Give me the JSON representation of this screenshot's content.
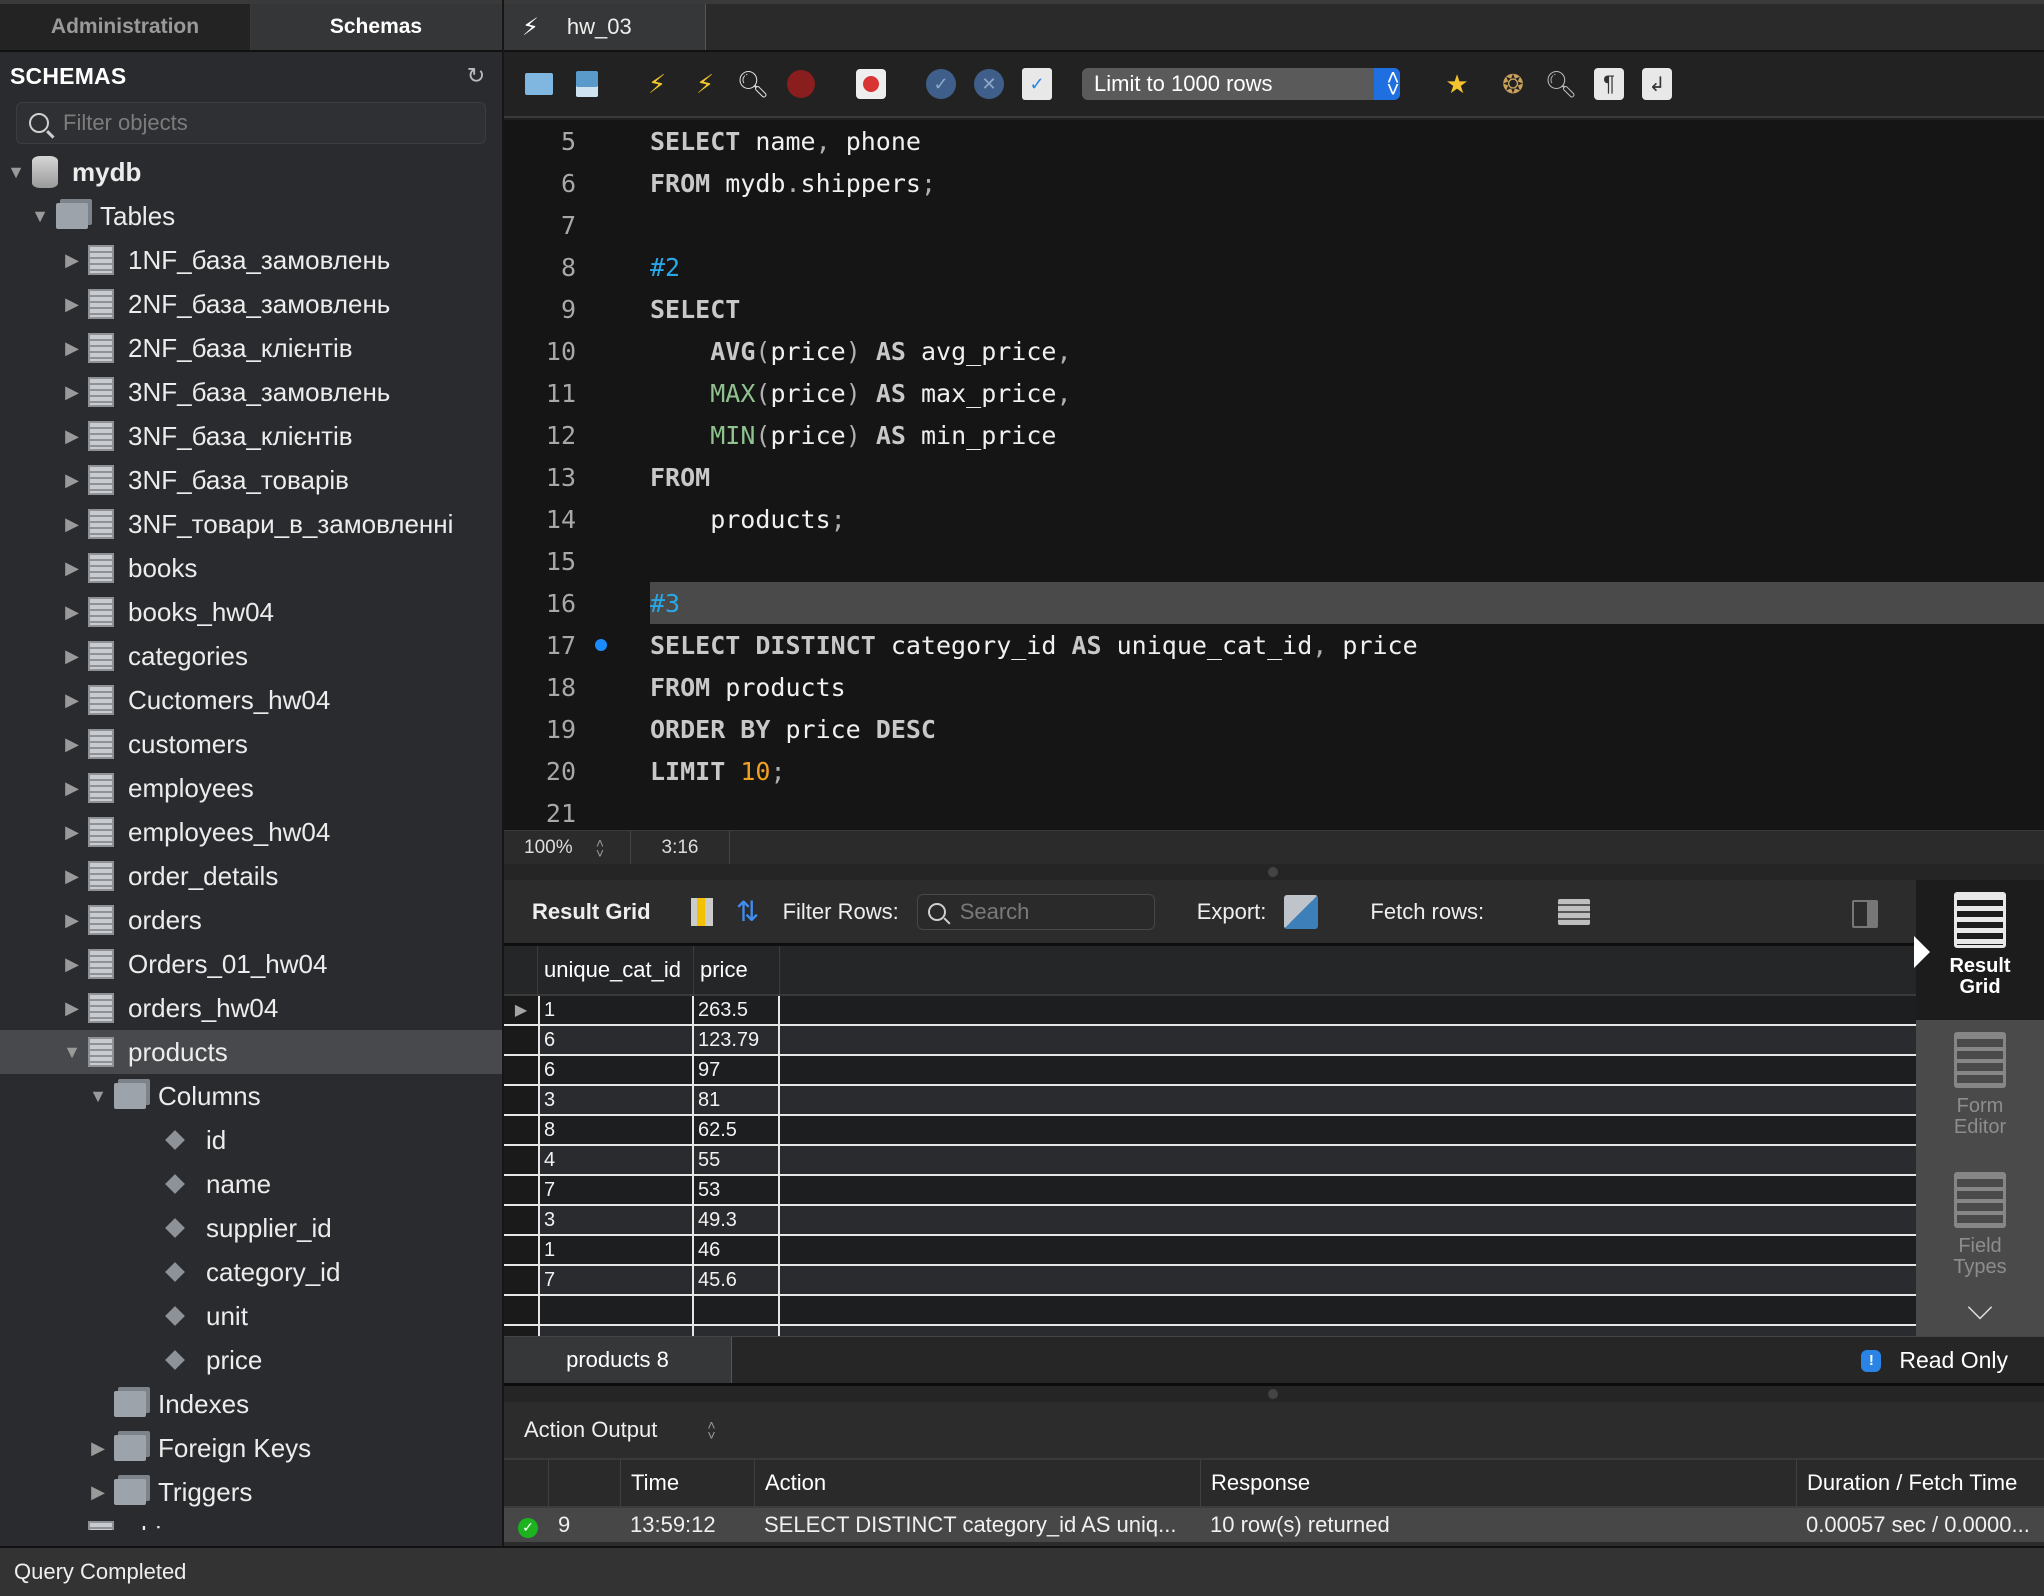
{
  "sidebar": {
    "tabs": [
      {
        "label": "Administration",
        "active": false
      },
      {
        "label": "Schemas",
        "active": true
      }
    ],
    "section_title": "SCHEMAS",
    "refresh_icon": "refresh-icon",
    "filter": {
      "placeholder": "Filter objects",
      "value": ""
    },
    "tree": {
      "schema": "mydb",
      "tables_label": "Tables",
      "tables": [
        "1NF_база_замовлень",
        "2NF_база_замовлень",
        "2NF_база_клієнтів",
        "3NF_база_замовлень",
        "3NF_база_клієнтів",
        "3NF_база_товарів",
        "3NF_товари_в_замовленні",
        "books",
        "books_hw04",
        "categories",
        "Cuctomers_hw04",
        "customers",
        "employees",
        "employees_hw04",
        "order_details",
        "orders",
        "Orders_01_hw04",
        "orders_hw04",
        "products"
      ],
      "selected_table": "products",
      "columns_label": "Columns",
      "columns": [
        "id",
        "name",
        "supplier_id",
        "category_id",
        "unit",
        "price"
      ],
      "indexes_label": "Indexes",
      "foreign_keys_label": "Foreign Keys",
      "triggers_label": "Triggers",
      "next_table_partial": "shippers"
    }
  },
  "document_tab": {
    "label": "hw_03",
    "icon": "lightning-icon"
  },
  "toolbar": {
    "buttons": [
      {
        "name": "open-folder",
        "icon": "folder-icon"
      },
      {
        "name": "save",
        "icon": "save-icon"
      },
      {
        "name": "execute",
        "icon": "lightning-icon"
      },
      {
        "name": "execute-current",
        "icon": "lightning-cursor-icon"
      },
      {
        "name": "explain",
        "icon": "explain-magnifier-icon"
      },
      {
        "name": "stop",
        "icon": "stop-hand-icon"
      },
      {
        "name": "toggle-stop-on-error",
        "icon": "stop-on-error-icon"
      },
      {
        "name": "commit",
        "icon": "check-icon"
      },
      {
        "name": "rollback",
        "icon": "x-icon"
      },
      {
        "name": "autocommit",
        "icon": "autocommit-icon"
      },
      {
        "name": "add-snippet",
        "icon": "star-plus-icon"
      },
      {
        "name": "beautify",
        "icon": "broom-icon"
      },
      {
        "name": "find",
        "icon": "find-icon"
      },
      {
        "name": "invisible-chars",
        "icon": "pilcrow-icon"
      },
      {
        "name": "word-wrap",
        "icon": "wrap-icon"
      }
    ],
    "limit_select": "Limit to 1000 rows"
  },
  "editor": {
    "lines": [
      {
        "n": "5",
        "tokens": [
          [
            "kw",
            "SELECT"
          ],
          [
            "t",
            " "
          ],
          [
            "t",
            "name"
          ],
          [
            "punct",
            ","
          ],
          [
            "t",
            " phone"
          ]
        ]
      },
      {
        "n": "6",
        "tokens": [
          [
            "kw",
            "FROM"
          ],
          [
            "t",
            " mydb"
          ],
          [
            "punct",
            "."
          ],
          [
            "t",
            "shippers"
          ],
          [
            "punct",
            ";"
          ]
        ]
      },
      {
        "n": "7",
        "tokens": []
      },
      {
        "n": "8",
        "tokens": [
          [
            "cm",
            "#2"
          ]
        ]
      },
      {
        "n": "9",
        "tokens": [
          [
            "kw",
            "SELECT"
          ]
        ]
      },
      {
        "n": "10",
        "tokens": [
          [
            "t",
            "    "
          ],
          [
            "kw",
            "AVG"
          ],
          [
            "punct",
            "("
          ],
          [
            "t",
            "price"
          ],
          [
            "punct",
            ")"
          ],
          [
            "t",
            " "
          ],
          [
            "kw",
            "AS"
          ],
          [
            "t",
            " avg_price"
          ],
          [
            "punct",
            ","
          ]
        ]
      },
      {
        "n": "11",
        "tokens": [
          [
            "t",
            "    "
          ],
          [
            "fn",
            "MAX"
          ],
          [
            "punct",
            "("
          ],
          [
            "t",
            "price"
          ],
          [
            "punct",
            ")"
          ],
          [
            "t",
            " "
          ],
          [
            "kw",
            "AS"
          ],
          [
            "t",
            " max_price"
          ],
          [
            "punct",
            ","
          ]
        ]
      },
      {
        "n": "12",
        "tokens": [
          [
            "t",
            "    "
          ],
          [
            "fn",
            "MIN"
          ],
          [
            "punct",
            "("
          ],
          [
            "t",
            "price"
          ],
          [
            "punct",
            ")"
          ],
          [
            "t",
            " "
          ],
          [
            "kw",
            "AS"
          ],
          [
            "t",
            " min_price"
          ]
        ]
      },
      {
        "n": "13",
        "tokens": [
          [
            "kw",
            "FROM"
          ]
        ]
      },
      {
        "n": "14",
        "tokens": [
          [
            "t",
            "    products"
          ],
          [
            "punct",
            ";"
          ]
        ]
      },
      {
        "n": "15",
        "tokens": []
      },
      {
        "n": "16",
        "tokens": [
          [
            "cm",
            "#3"
          ]
        ],
        "highlight": true
      },
      {
        "n": "17",
        "tokens": [
          [
            "kw",
            "SELECT DISTINCT"
          ],
          [
            "t",
            " category_id "
          ],
          [
            "kw",
            "AS"
          ],
          [
            "t",
            " unique_cat_id"
          ],
          [
            "punct",
            ","
          ],
          [
            "t",
            " price"
          ]
        ],
        "marker": true
      },
      {
        "n": "18",
        "tokens": [
          [
            "kw",
            "FROM"
          ],
          [
            "t",
            " products"
          ]
        ]
      },
      {
        "n": "19",
        "tokens": [
          [
            "kw",
            "ORDER BY"
          ],
          [
            "t",
            " price "
          ],
          [
            "kw",
            "DESC"
          ]
        ]
      },
      {
        "n": "20",
        "tokens": [
          [
            "kw",
            "LIMIT"
          ],
          [
            "t",
            " "
          ],
          [
            "num",
            "10"
          ],
          [
            "punct",
            ";"
          ]
        ]
      },
      {
        "n": "21",
        "tokens": []
      }
    ],
    "zoom_level": "100%",
    "cursor_position": "3:16"
  },
  "result_toolbar": {
    "title": "Result Grid",
    "filter_label": "Filter Rows:",
    "search_placeholder": "Search",
    "export_label": "Export:",
    "fetch_label": "Fetch rows:"
  },
  "result_grid": {
    "columns": [
      "unique_cat_id",
      "price"
    ],
    "rows": [
      [
        "1",
        "263.5"
      ],
      [
        "6",
        "123.79"
      ],
      [
        "6",
        "97"
      ],
      [
        "3",
        "81"
      ],
      [
        "8",
        "62.5"
      ],
      [
        "4",
        "55"
      ],
      [
        "7",
        "53"
      ],
      [
        "3",
        "49.3"
      ],
      [
        "1",
        "46"
      ],
      [
        "7",
        "45.6"
      ]
    ],
    "current_row_index": 0
  },
  "side_switcher": [
    {
      "label": "Result Grid",
      "icon": "result-grid-icon",
      "active": true
    },
    {
      "label": "Form Editor",
      "icon": "form-editor-icon",
      "active": false
    },
    {
      "label": "Field Types",
      "icon": "field-types-icon",
      "active": false
    }
  ],
  "result_tabs": {
    "tabs": [
      {
        "label": "products 8",
        "active": true
      }
    ],
    "read_only_label": "Read Only"
  },
  "action_output": {
    "selector_label": "Action Output",
    "columns": [
      "",
      "",
      "Time",
      "Action",
      "Response",
      "Duration / Fetch Time"
    ],
    "rows": [
      {
        "status": "success",
        "index": "9",
        "time": "13:59:12",
        "action": "SELECT DISTINCT category_id AS uniq...",
        "response": "10 row(s) returned",
        "duration": "0.00057 sec / 0.0000..."
      }
    ]
  },
  "status_bar": {
    "text": "Query Completed"
  },
  "colors": {
    "accent_blue": "#1f6fe0",
    "comment": "#2aa7e6",
    "number": "#f0a020",
    "function": "#8fc28f",
    "success": "#1db320"
  }
}
